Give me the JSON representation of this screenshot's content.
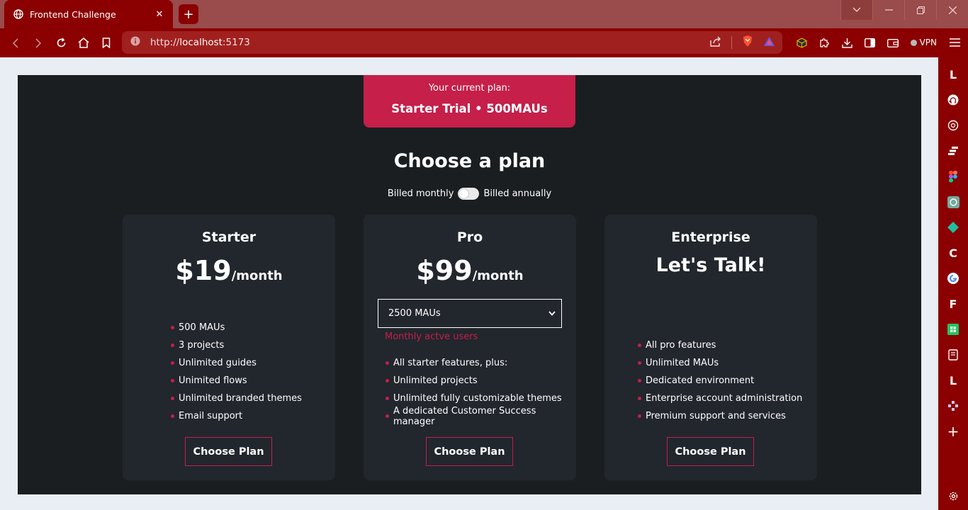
{
  "browser": {
    "tab_title": "Frontend Challenge",
    "url_scheme": "http://",
    "url_host": "localhost",
    "url_port": ":5173",
    "vpn_label": "VPN",
    "new_tab_glyph": "+",
    "close_glyph": "✕",
    "colors": {
      "chrome": "#8b0000",
      "titlebar": "#9a4b4b"
    }
  },
  "sidepanel": {
    "items": [
      {
        "icon": "letter-l-icon",
        "glyph": "L"
      },
      {
        "icon": "github-icon",
        "glyph": ""
      },
      {
        "icon": "openai-icon",
        "glyph": ""
      },
      {
        "icon": "stack-icon",
        "glyph": ""
      },
      {
        "icon": "figma-icon",
        "glyph": ""
      },
      {
        "icon": "chatgpt-icon",
        "glyph": ""
      },
      {
        "icon": "diamond-icon",
        "glyph": ""
      },
      {
        "icon": "letter-c-icon",
        "glyph": "C"
      },
      {
        "icon": "google-icon",
        "glyph": ""
      },
      {
        "icon": "letter-f-icon",
        "glyph": "F"
      },
      {
        "icon": "sheets-icon",
        "glyph": ""
      },
      {
        "icon": "notebook-icon",
        "glyph": ""
      },
      {
        "icon": "letter-l-icon",
        "glyph": "L"
      },
      {
        "icon": "puzzle-icon",
        "glyph": ""
      },
      {
        "icon": "add-icon",
        "glyph": "+"
      }
    ]
  },
  "page": {
    "current_plan_label": "Your current plan:",
    "current_plan_value": "Starter Trial • 500MAUs",
    "heading": "Choose a plan",
    "billed_monthly": "Billed monthly",
    "billed_annually": "Billed annually",
    "accent_color": "#c51f4a"
  },
  "plans": [
    {
      "name": "Starter",
      "price": "$19",
      "period": "/month",
      "features": [
        "500 MAUs",
        "3 projects",
        "Unlimited guides",
        "Unimited flows",
        "Unlimited branded themes",
        "Email support"
      ],
      "cta": "Choose Plan"
    },
    {
      "name": "Pro",
      "price": "$99",
      "period": "/month",
      "mau_selected": "2500 MAUs",
      "mau_help": "Monthly actve users",
      "features": [
        "All starter features, plus:",
        "Unlimited projects",
        "Unlimited fully customizable themes",
        "A dedicated Customer Success manager"
      ],
      "cta": "Choose Plan"
    },
    {
      "name": "Enterprise",
      "tagline": "Let's Talk!",
      "features": [
        "All pro features",
        "Unlimited MAUs",
        "Dedicated environment",
        "Enterprise account administration",
        "Premium support and services"
      ],
      "cta": "Choose Plan"
    }
  ]
}
